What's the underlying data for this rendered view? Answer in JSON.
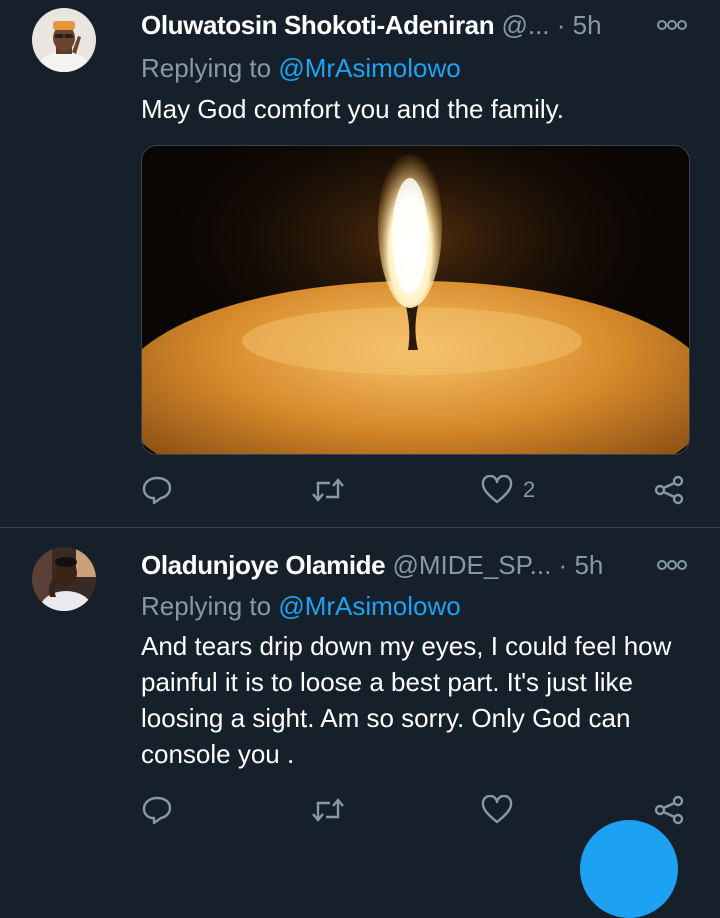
{
  "tweets": [
    {
      "name": "Oluwatosin Shokoti-Adeniran",
      "handle": "@...",
      "dot": "·",
      "time": "5h",
      "replying_prefix": "Replying to ",
      "replying_to": "@MrAsimolowo",
      "text": "May God comfort you and the family.",
      "has_media": true,
      "actions": {
        "reply_count": "",
        "retweet_count": "",
        "like_count": "2"
      }
    },
    {
      "name": "Oladunjoye Olamide",
      "handle": "@MIDE_SP...",
      "dot": "·",
      "time": "5h",
      "replying_prefix": "Replying to ",
      "replying_to": "@MrAsimolowo",
      "text": "And tears drip down my eyes, I could feel how painful it is to loose a best part. It's just like loosing a sight. Am so sorry. Only God can console you .",
      "has_media": false,
      "actions": {
        "reply_count": "",
        "retweet_count": "",
        "like_count": ""
      }
    }
  ],
  "icons": {
    "reply": "reply-icon",
    "retweet": "retweet-icon",
    "like": "heart-icon",
    "share": "share-icon",
    "more": "more-options-icon"
  },
  "colors": {
    "background": "#15202b",
    "divider": "#38444d",
    "secondary_text": "#8899a6",
    "accent": "#1da1f2"
  }
}
